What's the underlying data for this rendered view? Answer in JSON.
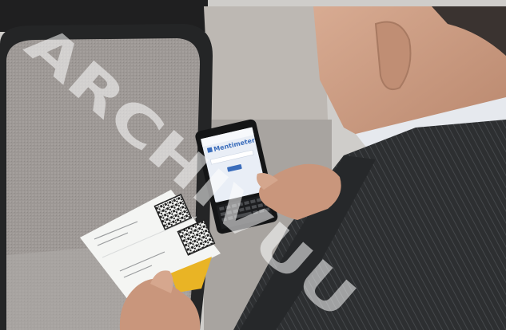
{
  "phone": {
    "app_name": "Mentimeter"
  },
  "watermark": {
    "text": "ARCHIVUU"
  },
  "colors": {
    "suit": "#2d2f31",
    "skin": "#c99a82",
    "card": "#f4f5f3",
    "card_accent": "#e9b425",
    "phone_screen": "#e9eef6",
    "brand_blue": "#3b6dbb",
    "chair_fabric": "#9d9895"
  }
}
